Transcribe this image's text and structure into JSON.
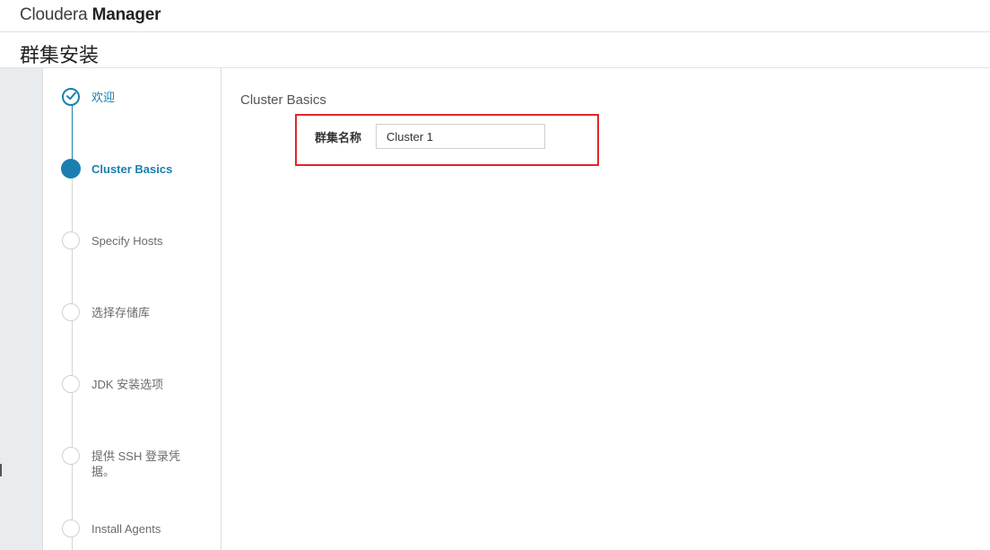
{
  "app": {
    "brand_light": "Cloudera",
    "brand_bold": "Manager"
  },
  "page": {
    "title": "群集安装"
  },
  "wizard": {
    "steps": [
      {
        "label": "欢迎",
        "state": "done"
      },
      {
        "label": "Cluster Basics",
        "state": "active"
      },
      {
        "label": "Specify Hosts",
        "state": "pending"
      },
      {
        "label": "选择存储库",
        "state": "pending"
      },
      {
        "label": "JDK 安装选项",
        "state": "pending"
      },
      {
        "label": "提供 SSH 登录凭据。",
        "state": "pending"
      },
      {
        "label": "Install Agents",
        "state": "pending"
      }
    ]
  },
  "main": {
    "section_title": "Cluster Basics",
    "cluster_name_label": "群集名称",
    "cluster_name_value": "Cluster 1"
  },
  "colors": {
    "accent": "#1a7fb0",
    "highlight": "#e2262a",
    "gutter": "#e9ecee"
  }
}
